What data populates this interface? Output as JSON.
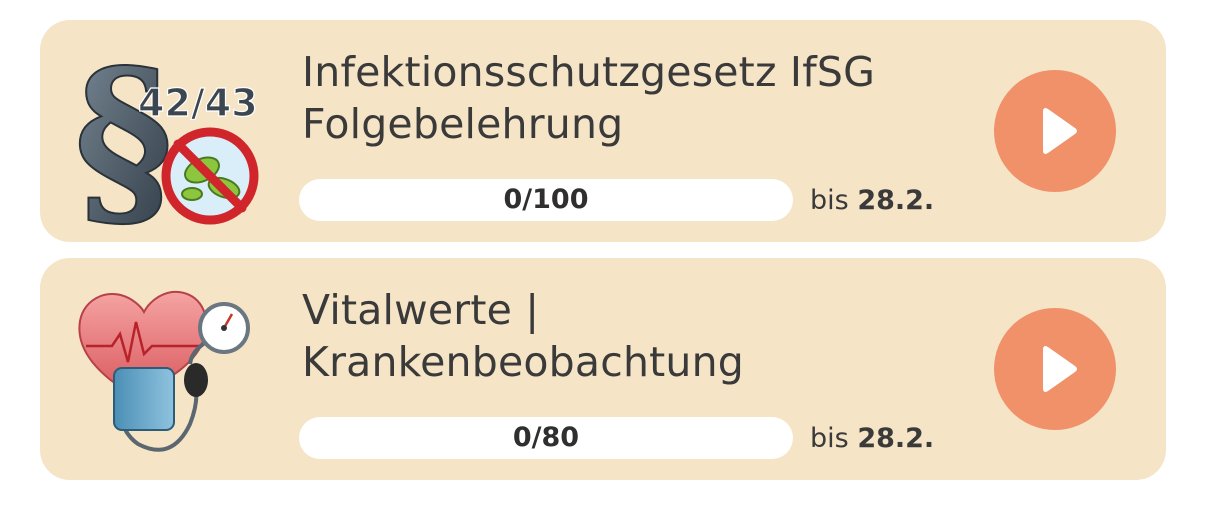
{
  "courses": [
    {
      "icon": "law-paragraph-virus-icon",
      "icon_text": "42/43",
      "title_line1": "Infektionsschutzgesetz IfSG",
      "title_line2": "Folgebelehrung",
      "progress_label": "0/100",
      "progress_fraction": 0,
      "due_prefix": "bis",
      "due_date": "28.2."
    },
    {
      "icon": "heart-blood-pressure-icon",
      "title_line1": "Vitalwerte |",
      "title_line2": "Krankenbeobachtung",
      "progress_label": "0/80",
      "progress_fraction": 0,
      "due_prefix": "bis",
      "due_date": "28.2."
    }
  ],
  "colors": {
    "card_background": "#f5e4c6",
    "accent": "#f0916a",
    "text": "#3a3a3a"
  },
  "play_icon": "play-icon"
}
